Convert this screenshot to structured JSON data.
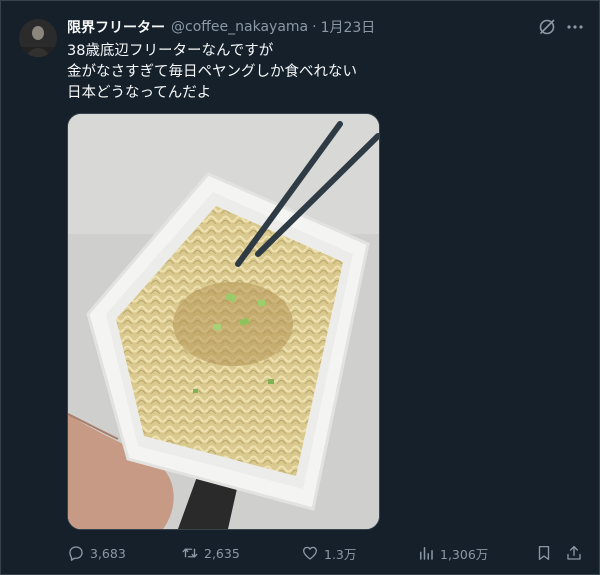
{
  "tweet": {
    "author": {
      "display_name": "限界フリーター",
      "handle": "@coffee_nakayama",
      "avatar": "avatar-photo"
    },
    "separator": "·",
    "timestamp": "1月23日",
    "text_lines": [
      "38歳底辺フリーターなんですが",
      "金がなさすぎて毎日ペヤングしか食べれない",
      "日本どうなってんだよ"
    ],
    "media": {
      "icon": "photo-noodles-in-container"
    },
    "header_icons": [
      "grok-icon",
      "more-icon"
    ]
  },
  "actions": {
    "reply": {
      "icon": "reply-icon",
      "count": "3,683"
    },
    "retweet": {
      "icon": "retweet-icon",
      "count": "2,635"
    },
    "like": {
      "icon": "like-icon",
      "count": "1.3万"
    },
    "views": {
      "icon": "views-icon",
      "count": "1,306万"
    },
    "bookmark": {
      "icon": "bookmark-icon"
    },
    "share": {
      "icon": "share-icon"
    }
  },
  "colors": {
    "background": "#15202b",
    "text": "#f7f9f9",
    "secondary": "#8b98a5",
    "border": "#38444d"
  }
}
